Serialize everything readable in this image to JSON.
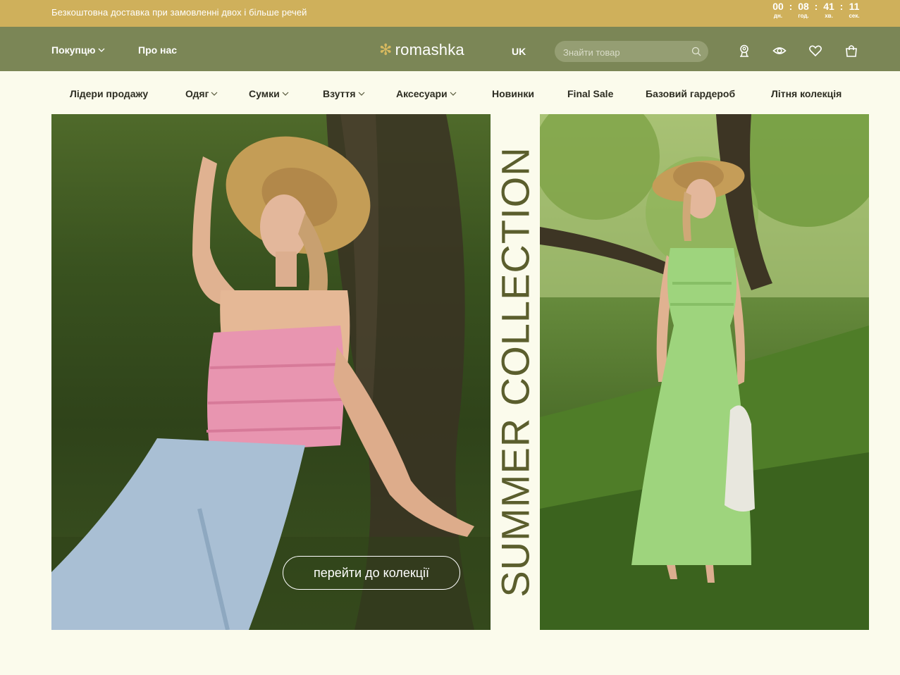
{
  "promo": {
    "text": "Безкоштовна доставка при замовленні двох і більше речей",
    "timer": {
      "days": "00",
      "hours": "08",
      "minutes": "41",
      "seconds": "11",
      "days_label": "дн.",
      "hours_label": "год.",
      "minutes_label": "хв.",
      "seconds_label": "сек."
    }
  },
  "header": {
    "shop_label": "Покупцю",
    "about_label": "Про нас",
    "logo_text": "romashka",
    "language": "UK",
    "search_placeholder": "Знайти товар"
  },
  "categories": [
    {
      "label": "Лідери продажу",
      "dropdown": false
    },
    {
      "label": "Одяг",
      "dropdown": true
    },
    {
      "label": "Сумки",
      "dropdown": true
    },
    {
      "label": "Взуття",
      "dropdown": true
    },
    {
      "label": "Аксесуари",
      "dropdown": true
    },
    {
      "label": "Новинки",
      "dropdown": false
    },
    {
      "label": "Final Sale",
      "dropdown": false
    },
    {
      "label": "Базовий гардероб",
      "dropdown": false
    },
    {
      "label": "Літня колекція",
      "dropdown": false
    }
  ],
  "hero": {
    "vertical_title": "SUMMER COLLECTION",
    "cta_label": "перейти до колекції"
  },
  "colors": {
    "promo_bg": "#cfb05b",
    "header_bg": "#7b8656",
    "page_bg": "#fbfbec",
    "accent_text": "#5b5e2d"
  }
}
